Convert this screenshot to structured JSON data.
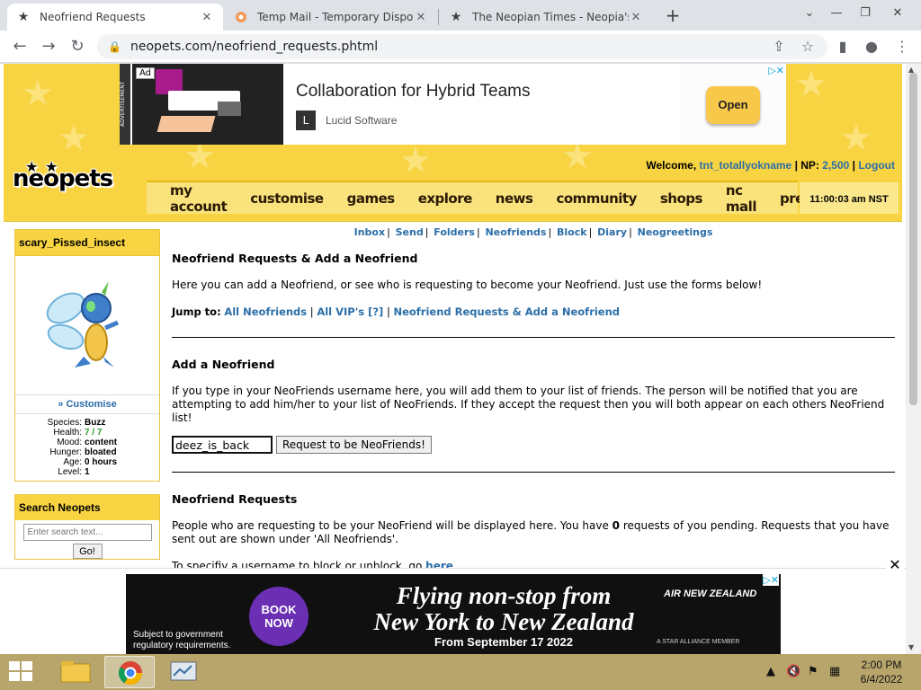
{
  "browser": {
    "tabs": [
      {
        "title": "Neofriend Requests",
        "icon": "star-icon"
      },
      {
        "title": "Temp Mail - Temporary Disposab",
        "icon": "tempmail-icon"
      },
      {
        "title": "The Neopian Times - Neopia's fi",
        "icon": "star-icon"
      }
    ],
    "url": "neopets.com/neofriend_requests.phtml"
  },
  "top_ad": {
    "badge": "Ad",
    "side_label": "ADVERTISEMENT",
    "title": "Collaboration for Hybrid Teams",
    "sponsor": "Lucid Software",
    "button": "Open"
  },
  "header": {
    "welcome_label": "Welcome,",
    "username": "tnt_totallyokname",
    "np_label": "| NP:",
    "np_value": "2,500",
    "logout": "Logout",
    "logo": "neopets",
    "clock": "11:00:03 am NST",
    "nav": [
      "my account",
      "customise",
      "games",
      "explore",
      "news",
      "community",
      "shops",
      "nc mall",
      "premium"
    ]
  },
  "sidebar": {
    "pet_name": "scary_Pissed_insect",
    "customise": "» Customise",
    "stats": {
      "species_label": "Species:",
      "species": "Buzz",
      "health_label": "Health:",
      "health_cur": "7",
      "health_sep": "/",
      "health_max": "7",
      "mood_label": "Mood:",
      "mood": "content",
      "hunger_label": "Hunger:",
      "hunger": "bloated",
      "age_label": "Age:",
      "age": "0 hours",
      "level_label": "Level:",
      "level": "1"
    },
    "search_title": "Search Neopets",
    "search_placeholder": "Enter search text...",
    "go": "Go!"
  },
  "content": {
    "subnav": [
      "Inbox",
      "Send",
      "Folders",
      "Neofriends",
      "Block",
      "Diary",
      "Neogreetings"
    ],
    "subnav_sep": "|",
    "title": "Neofriend Requests & Add a Neofriend",
    "intro": "Here you can add a Neofriend, or see who is requesting to become your Neofriend. Just use the forms below!",
    "jump_label": "Jump to:",
    "jump_links": [
      "All Neofriends",
      "All VIP's [?]",
      "Neofriend Requests & Add a Neofriend"
    ],
    "add_title": "Add a Neofriend",
    "add_text": "If you type in your NeoFriends username here, you will add them to your list of friends. The person will be notified that you are attempting to add him/her to your list of NeoFriends. If they accept the request then you will both appear on each others NeoFriend list!",
    "add_input_value": "deez_is_back",
    "add_button": "Request to be NeoFriends!",
    "req_title": "Neofriend Requests",
    "req_text_1": "People who are requesting to be your NeoFriend will be displayed here. You have",
    "req_count": "0",
    "req_text_2": "requests of you pending. Requests that you have sent out are shown under 'All Neofriends'.",
    "block_text": "To specifiy a username to block or unblock, go",
    "block_link": "here",
    "block_end": "."
  },
  "bottom_ad": {
    "book": "BOOK NOW",
    "headline_1": "Flying non-stop from",
    "headline_2": "New York to New Zealand",
    "date": "From September 17 2022",
    "brand": "AIR NEW ZEALAND",
    "alliance": "A STAR ALLIANCE MEMBER",
    "disclaimer_1": "Subject to government",
    "disclaimer_2": "regulatory requirements.",
    "close": "✕"
  },
  "taskbar": {
    "time": "2:00 PM",
    "date": "6/4/2022"
  }
}
